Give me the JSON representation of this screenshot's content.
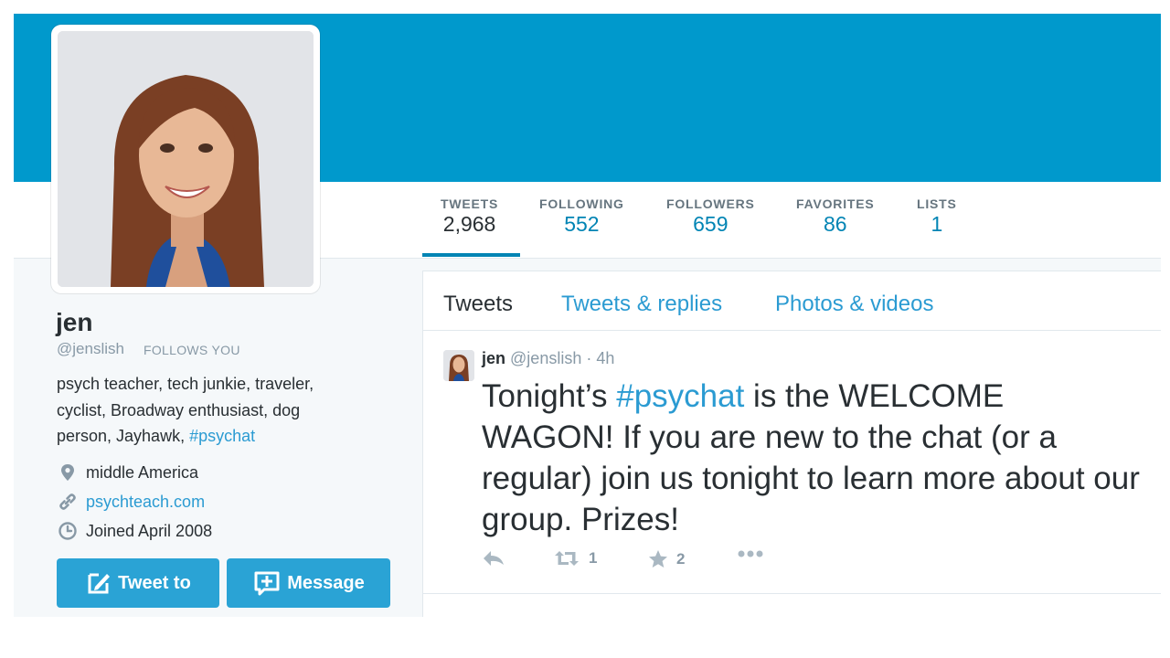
{
  "profile": {
    "name": "jen",
    "screen_name": "@jenslish",
    "follows_you": "FOLLOWS YOU",
    "bio_text": "psych teacher, tech junkie, traveler, cyclist, Broadway enthusiast, dog person, Jayhawk, ",
    "bio_hashtag": "#psychat",
    "location": "middle America",
    "website": "psychteach.com",
    "joined": "Joined April 2008"
  },
  "stats": [
    {
      "label": "TWEETS",
      "value": "2,968"
    },
    {
      "label": "FOLLOWING",
      "value": "552"
    },
    {
      "label": "FOLLOWERS",
      "value": "659"
    },
    {
      "label": "FAVORITES",
      "value": "86"
    },
    {
      "label": "LISTS",
      "value": "1"
    }
  ],
  "buttons": {
    "tweet_to": "Tweet to",
    "message": "Message"
  },
  "tabs": [
    "Tweets",
    "Tweets & replies",
    "Photos & videos"
  ],
  "tweet": {
    "name": "jen",
    "handle": "@jenslish",
    "separator": "·",
    "time": "4h",
    "text_before": "Tonight’s ",
    "hashtag": "#psychat",
    "text_after": " is the WELCOME WAGON! If you are new to the chat (or a regular) join us tonight to learn more about our group.  Prizes!",
    "retweets": "1",
    "favorites": "2"
  },
  "icons": [
    "location-pin-icon",
    "link-icon",
    "calendar-icon",
    "compose-icon",
    "message-icon",
    "reply-icon",
    "retweet-icon",
    "star-icon",
    "more-icon"
  ],
  "colors": {
    "banner": "#0099cc",
    "link": "#2b9bd2",
    "button": "#2aa3d5",
    "background": "#f5f8fa"
  }
}
